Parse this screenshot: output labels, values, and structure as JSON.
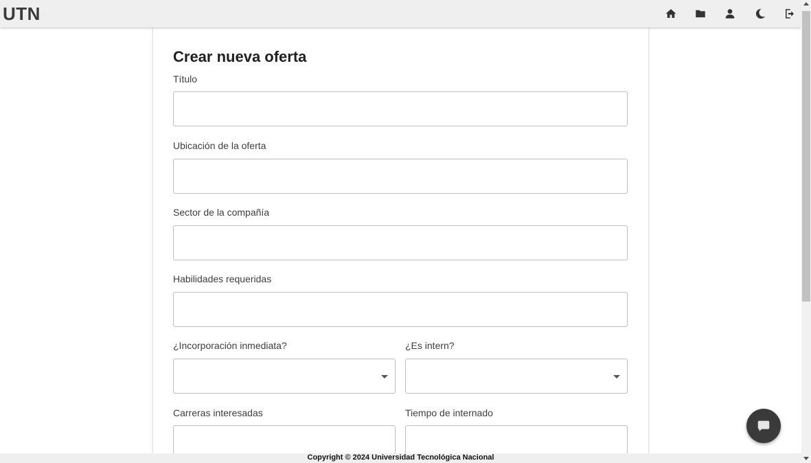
{
  "header": {
    "brand": "UTN",
    "icons": [
      "home-icon",
      "folder-icon",
      "user-icon",
      "moon-icon",
      "logout-icon"
    ]
  },
  "form": {
    "title": "Crear nueva oferta",
    "fields": {
      "titulo": {
        "label": "Título",
        "value": ""
      },
      "ubicacion": {
        "label": "Ubicación de la oferta",
        "value": ""
      },
      "sector": {
        "label": "Sector de la compañía",
        "value": ""
      },
      "habilidades": {
        "label": "Habilidades requeridas",
        "value": ""
      },
      "incorporacion": {
        "label": "¿Incorporación inmediata?",
        "value": ""
      },
      "intern": {
        "label": "¿Es intern?",
        "value": ""
      },
      "carreras": {
        "label": "Carreras interesadas",
        "value": ""
      },
      "tiempo": {
        "label": "Tiempo de internado",
        "value": ""
      }
    }
  },
  "footer": {
    "text": "Copyright © 2024 Universidad Tecnológica Nacional"
  },
  "chat": {
    "icon": "chat-bubble-icon"
  },
  "colors": {
    "topbar": "#efefef",
    "brand": "#3a3a3a",
    "chat_button": "#3a3a3a"
  }
}
